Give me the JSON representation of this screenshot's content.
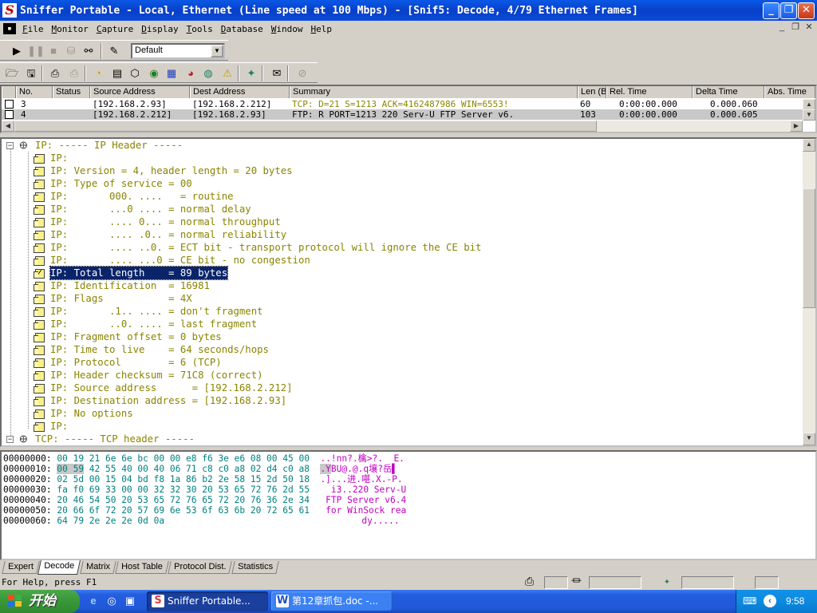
{
  "window": {
    "title": "Sniffer Portable - Local, Ethernet (Line speed at 100 Mbps) - [Snif5: Decode, 4/79 Ethernet Frames]",
    "app_icon_letter": "S"
  },
  "menu": [
    "File",
    "Monitor",
    "Capture",
    "Display",
    "Tools",
    "Database",
    "Window",
    "Help"
  ],
  "toolbar": {
    "filter_value": "Default"
  },
  "packet_list": {
    "columns": [
      "No.",
      "Status",
      "Source Address",
      "Dest Address",
      "Summary",
      "Len (B",
      "Rel. Time",
      "Delta Time",
      "Abs. Time"
    ],
    "rows": [
      {
        "no": "3",
        "status": "",
        "src": "[192.168.2.93]",
        "dst": "[192.168.2.212]",
        "summary": "TCP: D=21 S=1213     ACK=4162487986 WIN=6553!",
        "len": "60",
        "rel": "0:00:00.000",
        "delta": "0.000.060",
        "abs": ""
      },
      {
        "no": "4",
        "status": "",
        "src": "[192.168.2.212]",
        "dst": "[192.168.2.93]",
        "summary": "FTP: R PORT=1213   220 Serv-U FTP Server v6.",
        "len": "103",
        "rel": "0:00:00.000",
        "delta": "0.000.605",
        "abs": ""
      }
    ]
  },
  "decode": {
    "lines": [
      "IP: ----- IP Header -----",
      "IP:",
      "IP: Version = 4, header length = 20 bytes",
      "IP: Type of service = 00",
      "IP:       000. ....   = routine",
      "IP:       ...0 .... = normal delay",
      "IP:       .... 0... = normal throughput",
      "IP:       .... .0.. = normal reliability",
      "IP:       .... ..0. = ECT bit - transport protocol will ignore the CE bit",
      "IP:       .... ...0 = CE bit - no congestion",
      "IP: Total length    = 89 bytes",
      "IP: Identification  = 16981",
      "IP: Flags           = 4X",
      "IP:       .1.. .... = don't fragment",
      "IP:       ..0. .... = last fragment",
      "IP: Fragment offset = 0 bytes",
      "IP: Time to live    = 64 seconds/hops",
      "IP: Protocol        = 6 (TCP)",
      "IP: Header checksum = 71C8 (correct)",
      "IP: Source address      = [192.168.2.212]",
      "IP: Destination address = [192.168.2.93]",
      "IP: No options",
      "IP:",
      "TCP: ----- TCP header -----"
    ],
    "selected_index": 10
  },
  "hex": {
    "lines": [
      {
        "off": "00000000:",
        "hex": "00 19 21 6e 6e bc 00 00 e8 f6 3e e6 08 00 45 00",
        "asc": "..!nn?.檎>?.  E."
      },
      {
        "off": "00000010:",
        "hex": "00 59 42 55 40 00 40 06 71 c8 c0 a8 02 d4 c0 a8",
        "asc": ".YBU@.@.q壤?岳▌"
      },
      {
        "off": "00000020:",
        "hex": "02 5d 00 15 04 bd f8 1a 86 b2 2e 58 15 2d 50 18",
        "asc": ".]...进.啿.X.-P."
      },
      {
        "off": "00000030:",
        "hex": "fa f0 69 33 00 00 32 32 30 20 53 65 72 76 2d 55",
        "asc": "  i3..220 Serv-U"
      },
      {
        "off": "00000040:",
        "hex": "20 46 54 50 20 53 65 72 76 65 72 20 76 36 2e 34",
        "asc": " FTP Server v6.4"
      },
      {
        "off": "00000050:",
        "hex": "20 66 6f 72 20 57 69 6e 53 6f 63 6b 20 72 65 61",
        "asc": " for WinSock rea"
      },
      {
        "off": "00000060:",
        "hex": "64 79 2e 2e 2e 0d 0a",
        "asc": "dy....."
      }
    ],
    "selected_hex": "00 59",
    "selected_asc": ".Y"
  },
  "tabs": [
    "Expert",
    "Decode",
    "Matrix",
    "Host Table",
    "Protocol Dist.",
    "Statistics"
  ],
  "active_tab": "Decode",
  "status": {
    "help_text": "For Help, press F1"
  },
  "taskbar": {
    "start_label": "开始",
    "tasks": [
      {
        "label": "Sniffer Portable...",
        "active": true
      },
      {
        "label": "第12章抓包.doc -...",
        "active": false
      }
    ],
    "clock": "9:58"
  }
}
